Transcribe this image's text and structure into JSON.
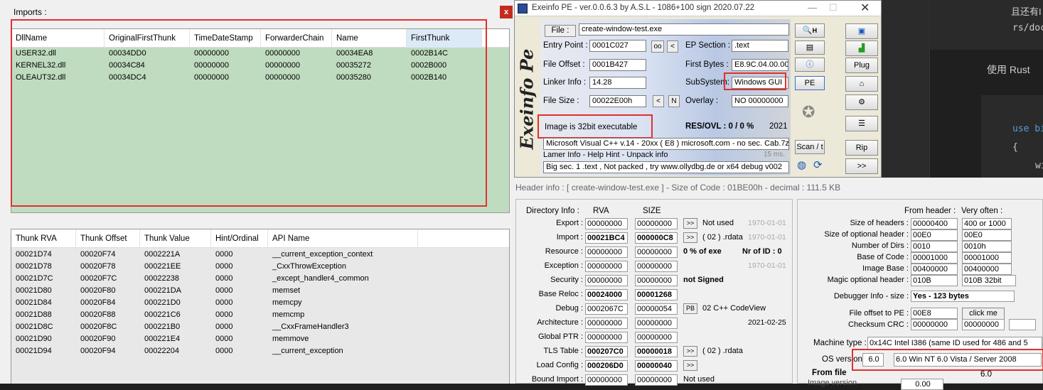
{
  "imports": {
    "title": "Imports :",
    "close_label": "x",
    "dll_headers": [
      "DllName",
      "OriginalFirstThunk",
      "TimeDateStamp",
      "ForwarderChain",
      "Name",
      "FirstThunk"
    ],
    "dll_rows": [
      [
        "USER32.dll",
        "00034DD0",
        "00000000",
        "00000000",
        "00034EA8",
        "0002B14C"
      ],
      [
        "KERNEL32.dll",
        "00034C84",
        "00000000",
        "00000000",
        "00035272",
        "0002B000"
      ],
      [
        "OLEAUT32.dll",
        "00034DC4",
        "00000000",
        "00000000",
        "00035280",
        "0002B140"
      ]
    ],
    "thunk_headers": [
      "Thunk RVA",
      "Thunk Offset",
      "Thunk Value",
      "Hint/Ordinal",
      "API Name"
    ],
    "thunk_rows": [
      [
        "00021D74",
        "00020F74",
        "0002221A",
        "0000",
        "__current_exception_context"
      ],
      [
        "00021D78",
        "00020F78",
        "000221EE",
        "0000",
        "_CxxThrowException"
      ],
      [
        "00021D7C",
        "00020F7C",
        "00022238",
        "0000",
        "_except_handler4_common"
      ],
      [
        "00021D80",
        "00020F80",
        "000221DA",
        "0000",
        "memset"
      ],
      [
        "00021D84",
        "00020F84",
        "000221D0",
        "0000",
        "memcpy"
      ],
      [
        "00021D88",
        "00020F88",
        "000221C6",
        "0000",
        "memcmp"
      ],
      [
        "00021D8C",
        "00020F8C",
        "000221B0",
        "0000",
        "__CxxFrameHandler3"
      ],
      [
        "00021D90",
        "00020F90",
        "000221E4",
        "0000",
        "memmove"
      ],
      [
        "00021D94",
        "00020F94",
        "00022204",
        "0000",
        "__current_exception"
      ]
    ]
  },
  "exeinfo": {
    "title": "Exeinfo PE - ver.0.0.6.3  by A.S.L -  1086+100 sign  2020.07.22",
    "file_label": "File :",
    "file_value": "create-window-test.exe",
    "entry_point_label": "Entry Point :",
    "entry_point": "0001C027",
    "oo": "oo",
    "lt": "<",
    "ep_section_label": "EP Section :",
    "ep_section": ".text",
    "file_offset_label": "File Offset :",
    "file_offset": "0001B427",
    "first_bytes_label": "First Bytes :",
    "first_bytes": "E8.9C.04.00.00",
    "linker_info_label": "Linker Info :",
    "linker_info": "14.28",
    "subsystem_label": "SubSystem:",
    "subsystem": "Windows GUI",
    "file_size_label": "File Size :",
    "file_size": "00022E00h",
    "n_btn": "N",
    "overlay_label": "Overlay :",
    "overlay": "NO  00000000",
    "image_info": "Image is 32bit executable",
    "res_ovl": "RES/OVL : 0 / 0 %",
    "year": "2021",
    "compiler": "Microsoft Visual C++ v.14 - 20xx ( E8 ) microsoft.com - no sec. Cab.7z",
    "lamer_info": "Lamer Info - Help Hint - Unpack info",
    "ms": "15 ms.",
    "hint": "Big sec. 1 .text , Not packed , try  www.ollydbg.de or x64 debug v002",
    "side_logo": "Exeinfo Pe",
    "buttons": {
      "h": "H",
      "plug": "Plug",
      "pe": "PE",
      "scan": "Scan / t",
      "rip": "Rip",
      "next": ">>"
    }
  },
  "header_info": {
    "caption": "Header info  :  [ create-window-test.exe ] - Size of Code : 01BE00h - decimal : 111.5 KB",
    "dir_title": "Directory Info :",
    "rva_label": "RVA",
    "size_label": "SIZE",
    "dirs": [
      {
        "name": "Export :",
        "rva": "00000000",
        "size": "00000000",
        "btn": ">>",
        "extra": "Not used",
        "date": "1970-01-01"
      },
      {
        "name": "Import :",
        "rva": "00021BC4",
        "size": "000000C8",
        "btn": ">>",
        "extra": "( 02 ) .rdata",
        "date": "1970-01-01"
      },
      {
        "name": "Resource :",
        "rva": "00000000",
        "size": "00000000",
        "btn": "",
        "extra": "0  % of exe",
        "date": "Nr of ID : 0"
      },
      {
        "name": "Exception :",
        "rva": "00000000",
        "size": "00000000",
        "btn": "",
        "extra": "",
        "date": "1970-01-01"
      },
      {
        "name": "Security :",
        "rva": "00000000",
        "size": "00000000",
        "btn": "",
        "extra": "not Signed",
        "date": ""
      },
      {
        "name": "Base Reloc :",
        "rva": "00024000",
        "size": "00001268",
        "btn": "",
        "extra": "",
        "date": ""
      },
      {
        "name": "Debug :",
        "rva": "0002067C",
        "size": "00000054",
        "btn": "PB",
        "extra": "02  C++ CodeView",
        "date": ""
      },
      {
        "name": "Architecture :",
        "rva": "00000000",
        "size": "00000000",
        "btn": "",
        "extra": "",
        "date": "2021-02-25"
      },
      {
        "name": "Global PTR :",
        "rva": "00000000",
        "size": "00000000",
        "btn": "",
        "extra": "",
        "date": ""
      },
      {
        "name": "TLS Table :",
        "rva": "000207C0",
        "size": "00000018",
        "btn": ">>",
        "extra": "( 02 ) .rdata",
        "date": ""
      },
      {
        "name": "Load Config :",
        "rva": "000206D0",
        "size": "00000040",
        "btn": ">>",
        "extra": "",
        "date": ""
      },
      {
        "name": "Bound Import :",
        "rva": "00000000",
        "size": "00000000",
        "btn": "",
        "extra": "Not used",
        "date": ""
      }
    ],
    "from_header": "From header :",
    "very_often": "Very often :",
    "hdr_rows": [
      {
        "label": "Size of headers :",
        "a": "00000400",
        "b": "400 or 1000"
      },
      {
        "label": "Size of optional header :",
        "a": "00E0",
        "b": "00E0"
      },
      {
        "label": "Number of Dirs :",
        "a": "0010",
        "b": "0010h"
      },
      {
        "label": "Base of Code :",
        "a": "00001000",
        "b": "00001000"
      },
      {
        "label": "Image Base :",
        "a": "00400000",
        "b": "00400000"
      },
      {
        "label": "Magic optional header :",
        "a": "010B",
        "b": "010B 32bit"
      }
    ],
    "debugger_label": "Debugger Info  -  size :",
    "debugger_value": "Yes   - 123 bytes",
    "file_offset_pe_label": "File offset to PE :",
    "file_offset_pe": "00E8",
    "click_me": "click me",
    "checksum_label": "Checksum CRC :",
    "checksum_a": "00000000",
    "checksum_b": "00000000",
    "machine_label": "Machine type :",
    "machine_value": "0x14C    Intel I386 (same ID used for 486 and 5",
    "os_label": "OS version :",
    "os_value": "6.0",
    "os_select": "6.0   Win NT 6.0 Vista / Server 2008",
    "from_file": "From file",
    "from_file_val": "6.0",
    "image_version": "Image version",
    "image_version_val": "0.00"
  },
  "code_panel": {
    "line1": "且还有I",
    "line2": "rs/doc",
    "line3": "使用 Rust",
    "line4": "use bi",
    "line5": "{",
    "line6": "wi"
  }
}
